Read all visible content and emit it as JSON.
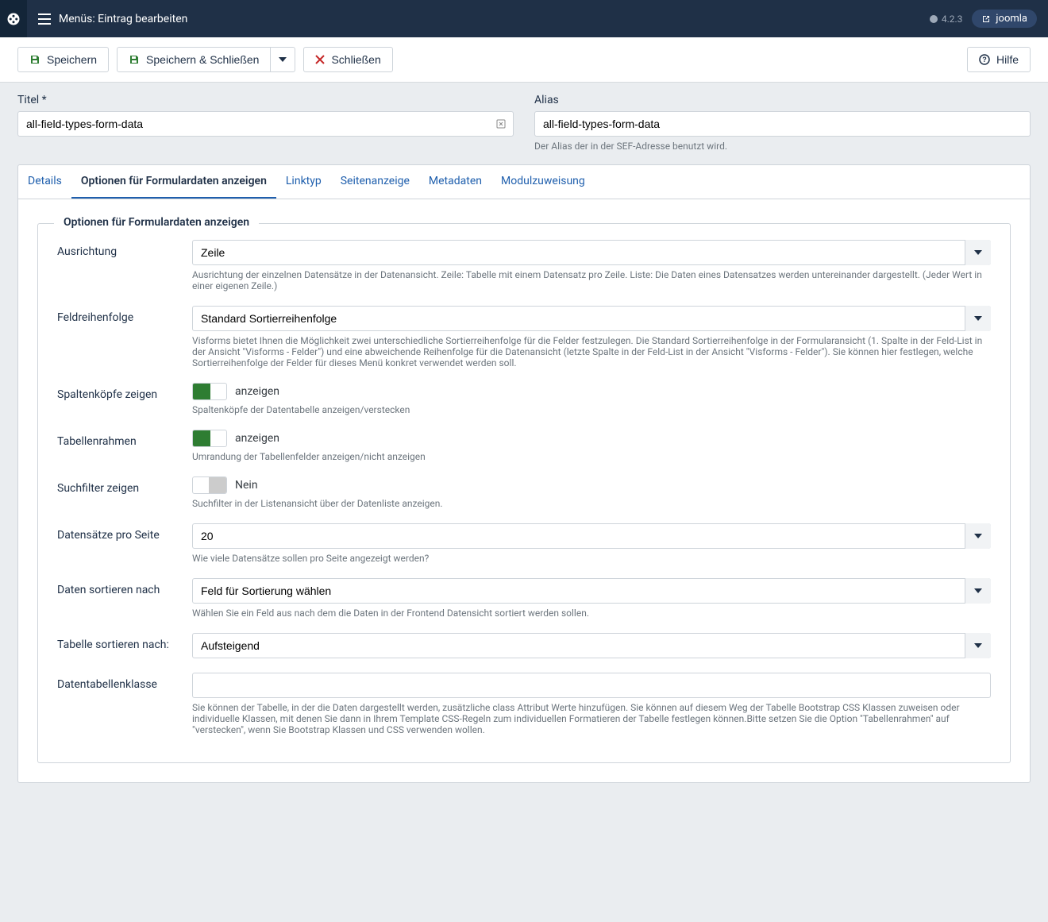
{
  "header": {
    "title": "Menüs: Eintrag bearbeiten",
    "version": "4.2.3",
    "badge": "joomla"
  },
  "toolbar": {
    "save": "Speichern",
    "save_close": "Speichern & Schließen",
    "close": "Schließen",
    "help": "Hilfe"
  },
  "form": {
    "title_label": "Titel *",
    "title_value": "all-field-types-form-data",
    "alias_label": "Alias",
    "alias_value": "all-field-types-form-data",
    "alias_desc": "Der Alias der in der SEF-Adresse benutzt wird."
  },
  "tabs": [
    "Details",
    "Optionen für Formulardaten anzeigen",
    "Linktyp",
    "Seitenanzeige",
    "Metadaten",
    "Modulzuweisung"
  ],
  "fieldset_legend": "Optionen für Formulardaten anzeigen",
  "fields": {
    "ausrichtung": {
      "label": "Ausrichtung",
      "value": "Zeile",
      "desc": "Ausrichtung der einzelnen Datensätze in der Datenansicht. Zeile: Tabelle mit einem Datensatz pro Zeile. Liste: Die Daten eines Datensatzes werden untereinander dargestellt. (Jeder Wert in einer eigenen Zeile.)"
    },
    "feldreihenfolge": {
      "label": "Feldreihenfolge",
      "value": "Standard Sortierreihenfolge",
      "desc": "Visforms bietet Ihnen die Möglichkeit zwei unterschiedliche Sortierreihenfolge für die Felder festzulegen. Die Standard Sortierreihenfolge in der Formularansicht (1. Spalte in der Feld-List in der Ansicht \"Visforms - Felder\") und eine abweichende Reihenfolge für die Datenansicht (letzte Spalte in der Feld-List in der Ansicht \"Visforms - Felder\"). Sie können hier festlegen, welche Sortierreihenfolge der Felder für dieses Menü konkret verwendet werden soll."
    },
    "spaltenkoepfe": {
      "label": "Spaltenköpfe zeigen",
      "value": "anzeigen",
      "desc": "Spaltenköpfe der Datentabelle anzeigen/verstecken"
    },
    "tabellenrahmen": {
      "label": "Tabellenrahmen",
      "value": "anzeigen",
      "desc": "Umrandung der Tabellenfelder anzeigen/nicht anzeigen"
    },
    "suchfilter": {
      "label": "Suchfilter zeigen",
      "value": "Nein",
      "desc": "Suchfilter in der Listenansicht über der Datenliste anzeigen."
    },
    "datensaetze": {
      "label": "Datensätze pro Seite",
      "value": "20",
      "desc": "Wie viele Datensätze sollen pro Seite angezeigt werden?"
    },
    "sortieren_nach": {
      "label": "Daten sortieren nach",
      "value": "Feld für Sortierung wählen",
      "desc": "Wählen Sie ein Feld aus nach dem die Daten in der Frontend Datensicht sortiert werden sollen."
    },
    "tabelle_sortieren": {
      "label": "Tabelle sortieren nach:",
      "value": "Aufsteigend"
    },
    "datentabellenklasse": {
      "label": "Datentabellenklasse",
      "value": "",
      "desc": "Sie können der Tabelle, in der die Daten dargestellt werden, zusätzliche class Attribut Werte hinzufügen. Sie können auf diesem Weg der Tabelle Bootstrap CSS Klassen zuweisen oder individuelle Klassen, mit denen Sie dann in Ihrem Template CSS-Regeln zum individuellen Formatieren der Tabelle festlegen können.Bitte setzen Sie die Option \"Tabellenrahmen\" auf \"verstecken\", wenn Sie Bootstrap Klassen und CSS verwenden wollen."
    }
  }
}
